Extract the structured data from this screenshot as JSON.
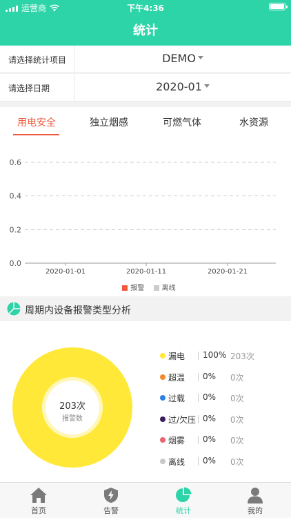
{
  "status_bar": {
    "carrier": "运营商",
    "time": "下午4:36"
  },
  "header": {
    "title": "统计"
  },
  "filters": [
    {
      "label": "请选择统计项目",
      "value": "DEMO"
    },
    {
      "label": "请选择日期",
      "value": "2020-01"
    }
  ],
  "tabs": [
    {
      "label": "用电安全",
      "active": true
    },
    {
      "label": "独立烟感",
      "active": false
    },
    {
      "label": "可燃气体",
      "active": false
    },
    {
      "label": "水资源",
      "active": false
    }
  ],
  "chart_data": {
    "type": "bar",
    "x_tick_labels": [
      "2020-01-01",
      "2020-01-11",
      "2020-01-21"
    ],
    "y_ticks": [
      "0.0",
      "0.2",
      "0.4",
      "0.6"
    ],
    "ylim": [
      0,
      0.6
    ],
    "grid": true,
    "legend_position": "bottom",
    "series": [
      {
        "name": "报警",
        "color": "#ee5a3c",
        "values": []
      },
      {
        "name": "离线",
        "color": "#cccccc",
        "values": []
      }
    ]
  },
  "analysis": {
    "title": "周期内设备报警类型分析",
    "total_count": "203次",
    "total_label": "报警数",
    "accent_color": "#ffe838",
    "items": [
      {
        "name": "漏电",
        "percent": "100%",
        "count": "203次",
        "color": "#ffe838",
        "share": 1.0
      },
      {
        "name": "超温",
        "percent": "0%",
        "count": "0次",
        "color": "#f28a2e",
        "share": 0
      },
      {
        "name": "过载",
        "percent": "0%",
        "count": "0次",
        "color": "#2f7fe0",
        "share": 0
      },
      {
        "name": "过/欠压",
        "percent": "0%",
        "count": "0次",
        "color": "#3a1f5d",
        "share": 0
      },
      {
        "name": "烟雾",
        "percent": "0%",
        "count": "0次",
        "color": "#e8636e",
        "share": 0
      },
      {
        "name": "离线",
        "percent": "0%",
        "count": "0次",
        "color": "#c8c8c8",
        "share": 0
      }
    ]
  },
  "tabbar": [
    {
      "label": "首页",
      "icon": "home-icon",
      "active": false
    },
    {
      "label": "告警",
      "icon": "alert-shield-icon",
      "active": false
    },
    {
      "label": "统计",
      "icon": "pie-chart-icon",
      "active": true
    },
    {
      "label": "我的",
      "icon": "user-icon",
      "active": false
    }
  ]
}
